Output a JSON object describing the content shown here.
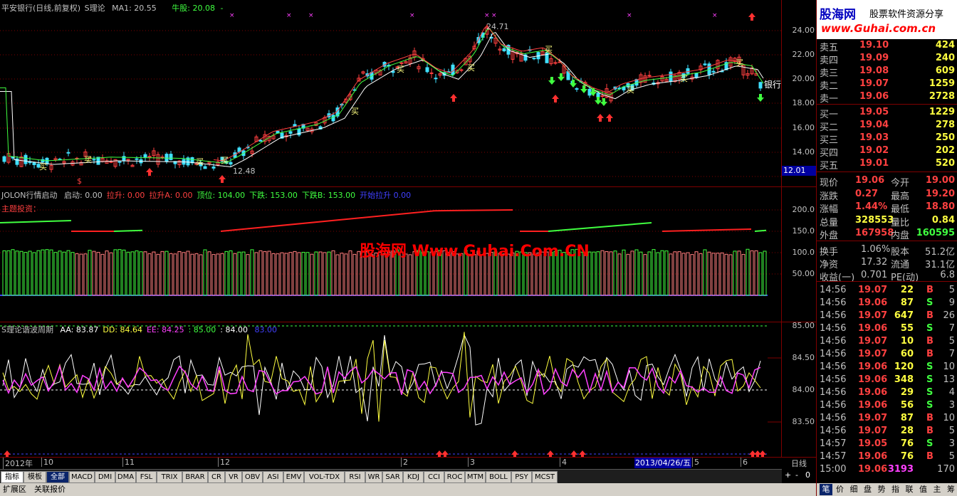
{
  "title_bar": {
    "stock": "平安银行(日线,前复权)",
    "indicator": "S理论",
    "ma_label": "MA1: 20.55",
    "bull_label": "牛股: 20.08",
    "bull_suffix": "-"
  },
  "price_axis": [
    "24.00",
    "22.00",
    "20.00",
    "18.00",
    "16.00",
    "14.00",
    "12.01"
  ],
  "price_annotations": {
    "high": "24.71",
    "low": "12.48",
    "name_tag": "银行",
    "buy": "买",
    "dollar": "$"
  },
  "panel2": {
    "name": "JOLON行情启动",
    "items": [
      {
        "label": "启动:",
        "value": "0.00",
        "color": "#c0c0c0"
      },
      {
        "label": "拉升:",
        "value": "0.00",
        "color": "#ff4040"
      },
      {
        "label": "拉升A:",
        "value": "0.00",
        "color": "#ff4040"
      },
      {
        "label": "顶位:",
        "value": "104.00",
        "color": "#40ff40"
      },
      {
        "label": "下跌:",
        "value": "153.00",
        "color": "#40ff40"
      },
      {
        "label": "下跌B:",
        "value": "153.00",
        "color": "#40ff40"
      },
      {
        "label": "开始拉升",
        "value": "0.00",
        "color": "#4040ff"
      }
    ],
    "subtitle": "主题投资：",
    "axis": [
      "200.0",
      "150.0",
      "100.0",
      "50.00"
    ]
  },
  "watermark": "股海网 Www.Guhai.Com.CN",
  "panel3": {
    "name": "S理论谐波周期",
    "items": [
      {
        "label": "AA:",
        "value": "83.87",
        "color": "#ffffff"
      },
      {
        "label": "DD:",
        "value": "84.64",
        "color": "#ffff40"
      },
      {
        "label": "EE:",
        "value": "84.25",
        "color": "#ff40ff"
      },
      {
        "label": ":",
        "value": "85.00",
        "color": "#40ff40"
      },
      {
        "label": ":",
        "value": "84.00",
        "color": "#ffffff"
      },
      {
        "label": "",
        "value": "83.00",
        "color": "#4040ff"
      }
    ],
    "axis": [
      "85.00",
      "84.50",
      "84.00",
      "83.50"
    ]
  },
  "x_axis": {
    "labels": [
      "2012年",
      "10",
      "11",
      "12",
      "2",
      "3",
      "4",
      "5",
      "6"
    ],
    "cursor_date": "2013/04/26/五",
    "period": "日线"
  },
  "tabs": [
    "指标",
    "模板",
    "全部",
    "MACD",
    "DMI",
    "DMA",
    "FSL",
    "TRIX",
    "BRAR",
    "CR",
    "VR",
    "OBV",
    "ASI",
    "EMV",
    "VOL-TDX",
    "RSI",
    "WR",
    "SAR",
    "KDJ",
    "CCI",
    "ROC",
    "MTM",
    "BOLL",
    "PSY",
    "MCST"
  ],
  "bottom_tabs": [
    "扩展区",
    "关联报价"
  ],
  "zoom_buttons": [
    "+",
    "-",
    "0"
  ],
  "logo": {
    "name": "股海网",
    "slogan": "股票软件资源分享",
    "url": "www.Guhai.com.cn"
  },
  "order_book": {
    "asks": [
      {
        "label": "卖五",
        "price": "19.10",
        "vol": "424"
      },
      {
        "label": "卖四",
        "price": "19.09",
        "vol": "240"
      },
      {
        "label": "卖三",
        "price": "19.08",
        "vol": "609"
      },
      {
        "label": "卖二",
        "price": "19.07",
        "vol": "1259"
      },
      {
        "label": "卖一",
        "price": "19.06",
        "vol": "2728"
      }
    ],
    "bids": [
      {
        "label": "买一",
        "price": "19.05",
        "vol": "1229"
      },
      {
        "label": "买二",
        "price": "19.04",
        "vol": "278"
      },
      {
        "label": "买三",
        "price": "19.03",
        "vol": "250"
      },
      {
        "label": "买四",
        "price": "19.02",
        "vol": "202"
      },
      {
        "label": "买五",
        "price": "19.01",
        "vol": "520"
      }
    ]
  },
  "quote": [
    {
      "l1": "现价",
      "v1": "19.06",
      "c1": "#ff4040",
      "l2": "今开",
      "v2": "19.00",
      "c2": "#ff4040"
    },
    {
      "l1": "涨跌",
      "v1": "0.27",
      "c1": "#ff4040",
      "l2": "最高",
      "v2": "19.20",
      "c2": "#ff4040"
    },
    {
      "l1": "涨幅",
      "v1": "1.44%",
      "c1": "#ff4040",
      "l2": "最低",
      "v2": "18.80",
      "c2": "#ff4040"
    },
    {
      "l1": "总量",
      "v1": "328553",
      "c1": "#ffff40",
      "l2": "量比",
      "v2": "0.84",
      "c2": "#ffff40"
    },
    {
      "l1": "外盘",
      "v1": "167958",
      "c1": "#ff4040",
      "l2": "内盘",
      "v2": "160595",
      "c2": "#40ff40"
    }
  ],
  "quote2": [
    {
      "l1": "换手",
      "v1": "1.06%",
      "l2": "股本",
      "v2": "51.2亿"
    },
    {
      "l1": "净资",
      "v1": "17.32",
      "l2": "流通",
      "v2": "31.1亿"
    },
    {
      "l1": "收益(一)",
      "v1": "0.701",
      "l2": "PE(动)",
      "v2": "6.8"
    }
  ],
  "ticks": [
    {
      "t": "14:56",
      "p": "19.07",
      "v": "22",
      "bs": "B",
      "n": "5"
    },
    {
      "t": "14:56",
      "p": "19.06",
      "v": "87",
      "bs": "S",
      "n": "9"
    },
    {
      "t": "14:56",
      "p": "19.07",
      "v": "647",
      "bs": "B",
      "n": "26"
    },
    {
      "t": "14:56",
      "p": "19.06",
      "v": "55",
      "bs": "S",
      "n": "7"
    },
    {
      "t": "14:56",
      "p": "19.07",
      "v": "10",
      "bs": "B",
      "n": "5"
    },
    {
      "t": "14:56",
      "p": "19.07",
      "v": "60",
      "bs": "B",
      "n": "7"
    },
    {
      "t": "14:56",
      "p": "19.06",
      "v": "120",
      "bs": "S",
      "n": "10"
    },
    {
      "t": "14:56",
      "p": "19.06",
      "v": "348",
      "bs": "S",
      "n": "13"
    },
    {
      "t": "14:56",
      "p": "19.06",
      "v": "29",
      "bs": "S",
      "n": "4"
    },
    {
      "t": "14:56",
      "p": "19.06",
      "v": "56",
      "bs": "S",
      "n": "3"
    },
    {
      "t": "14:56",
      "p": "19.07",
      "v": "87",
      "bs": "B",
      "n": "10"
    },
    {
      "t": "14:56",
      "p": "19.07",
      "v": "28",
      "bs": "B",
      "n": "5"
    },
    {
      "t": "14:57",
      "p": "19.05",
      "v": "76",
      "bs": "S",
      "n": "3"
    },
    {
      "t": "14:57",
      "p": "19.06",
      "v": "76",
      "bs": "B",
      "n": "5"
    },
    {
      "t": "15:00",
      "p": "19.06",
      "v": "3193",
      "bs": "",
      "n": "170"
    }
  ],
  "right_tabs": [
    "笔",
    "价",
    "细",
    "盘",
    "势",
    "指",
    "联",
    "值",
    "主",
    "筹"
  ]
}
